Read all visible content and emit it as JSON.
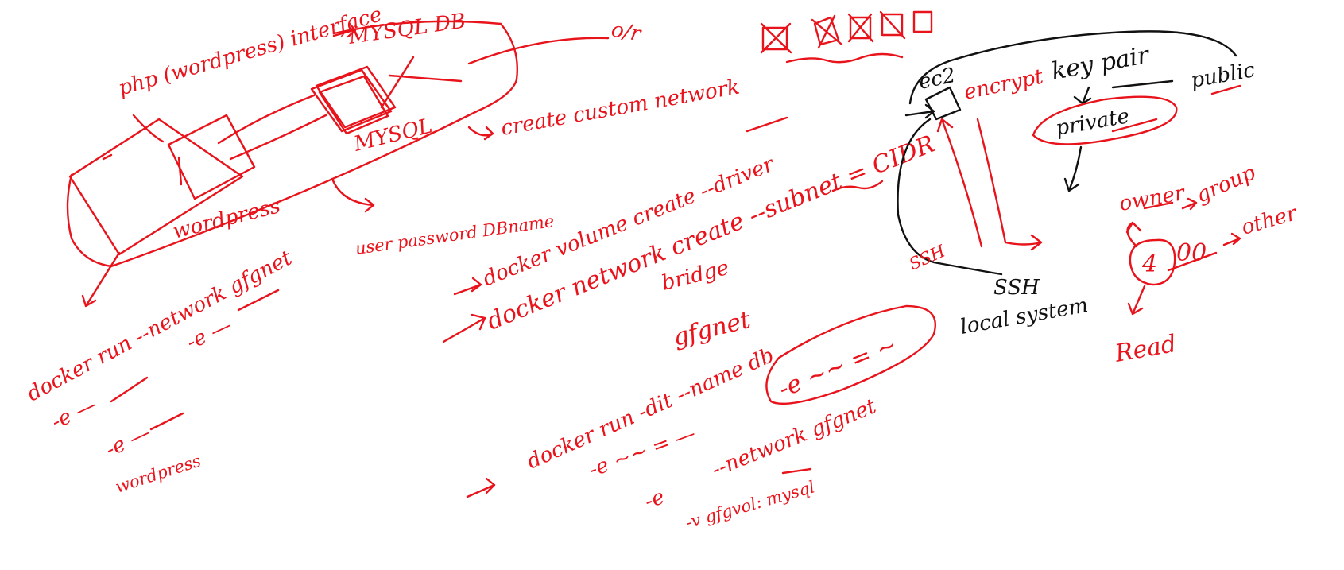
{
  "notes": {
    "php_interface": "php (wordpress) interface",
    "mysql_db": "MYSQL DB",
    "or": "o/r",
    "mysql": "MYSQL",
    "create_custom_network": "create custom network",
    "wordpress": "wordpress",
    "db_env": "user password DBname",
    "volume_create": "docker volume create --driver",
    "network_create": "docker network create --subnet = CIDR",
    "bridge": "bridge",
    "net_name": "gfgnet",
    "run_wp_1": "docker run --network gfgnet",
    "run_wp_e1": "-e —",
    "run_wp_e2": "-e —",
    "run_wp_e3": "-e —",
    "run_wp_image": "wordpress",
    "run_db_1": "docker run -dit --name db",
    "run_db_e1": "-e ~~ = ~",
    "run_db_e2": "-e ~~ = —",
    "run_db_net": "--network gfgnet",
    "run_db_e3": "-e",
    "run_db_vol": "-v gfgvol: mysql",
    "ec2": "ec2",
    "encrypt": "encrypt",
    "key_pair": "key pair",
    "public": "public",
    "private": "private",
    "ssh_left": "SSH",
    "ssh": "SSH",
    "local_system": "local system",
    "owner": "owner",
    "group": "group",
    "other": "other",
    "read": "Read",
    "perm_4": "4",
    "perm_00": "00"
  },
  "colors": {
    "ink": "#e8131b",
    "black": "#111111",
    "paper": "#ffffff"
  }
}
